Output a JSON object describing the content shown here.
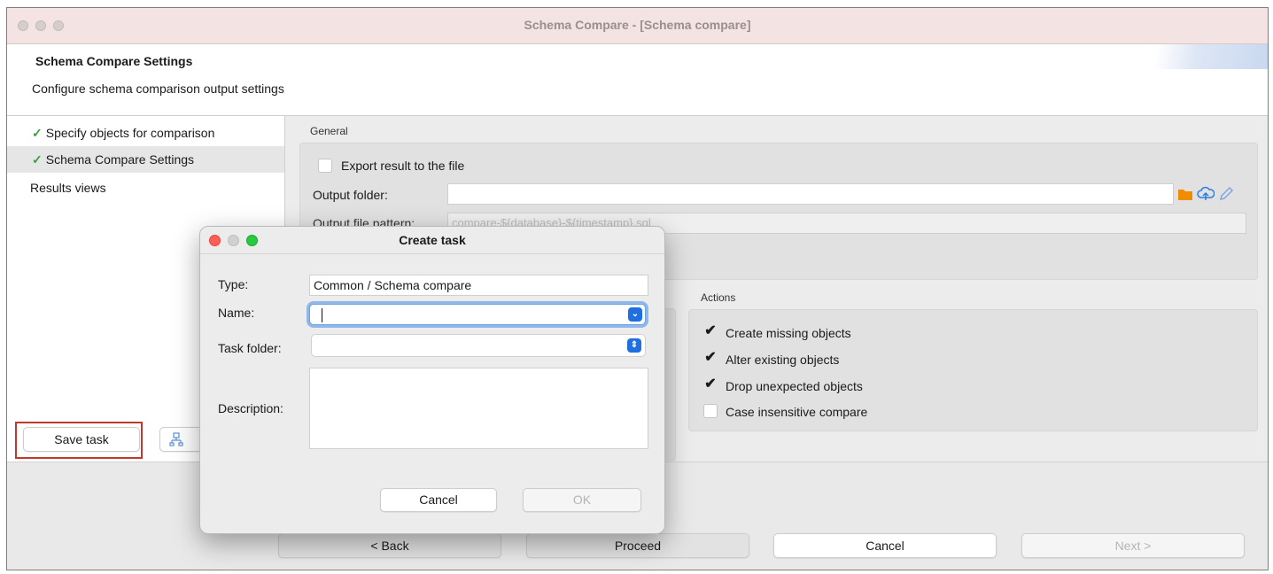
{
  "window": {
    "title": "Schema Compare - [Schema compare]"
  },
  "header": {
    "title": "Schema Compare Settings",
    "subtitle": "Configure schema comparison output settings"
  },
  "nav": {
    "items": [
      {
        "label": "Specify objects for comparison",
        "checked": true,
        "selected": false
      },
      {
        "label": "Schema Compare Settings",
        "checked": true,
        "selected": true
      },
      {
        "label": "Results views",
        "checked": false,
        "selected": false
      }
    ],
    "check_glyph": "✓"
  },
  "general": {
    "section_label": "General",
    "export_label": "Export result to the file",
    "output_folder_label": "Output folder:",
    "output_folder_value": "",
    "output_pattern_label": "Output file pattern:",
    "output_pattern_value": "compare-${database}-${timestamp}.sql"
  },
  "actions": {
    "section_label": "Actions",
    "items": [
      {
        "label": "Create missing objects",
        "checked": true
      },
      {
        "label": "Alter existing objects",
        "checked": true
      },
      {
        "label": "Drop unexpected objects",
        "checked": true
      },
      {
        "label": "Case insensitive compare",
        "checked": false
      }
    ],
    "check_glyph": "✔"
  },
  "footer": {
    "save_task_label": "Save task",
    "back_label": "< Back",
    "proceed_label": "Proceed",
    "cancel_label": "Cancel",
    "next_label": "Next >"
  },
  "dialog": {
    "title": "Create task",
    "type_label": "Type:",
    "type_value": "Common / Schema compare",
    "name_label": "Name:",
    "name_value": "",
    "folder_label": "Task folder:",
    "folder_value": "",
    "description_label": "Description:",
    "description_value": "",
    "cancel_label": "Cancel",
    "ok_label": "OK",
    "combo_glyph": "⌄",
    "stepper_glyph": "⇕"
  },
  "colors": {
    "accent": "#1f6fe0",
    "check_green": "#3aa03a",
    "highlight_red": "#c0392b",
    "folder_orange": "#f08c00",
    "link_blue": "#2a7de1",
    "traffic_red": "#ff5f57",
    "traffic_yellow": "#febc2e",
    "traffic_green": "#28c840"
  }
}
